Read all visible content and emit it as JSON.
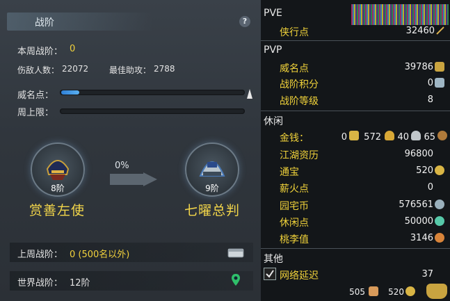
{
  "left": {
    "title": "战阶",
    "help_label": "?",
    "weekly_rank_label": "本周战阶：",
    "weekly_rank_value": "0",
    "kills_label": "伤敌人数：",
    "kills_value": "22072",
    "assist_label": "最佳助攻：",
    "assist_value": "2788",
    "fame_label": "威名点：",
    "fame_progress": 0.1,
    "weekly_cap_label": "周上限：",
    "weekly_cap_progress": 0,
    "current_rank": "8阶",
    "current_rank_name": "赏善左使",
    "progress_pct": "0%",
    "next_rank": "9阶",
    "next_rank_name": "七曜总判",
    "last_week_label": "上周战阶：",
    "last_week_value": "0 (500名以外)",
    "world_label": "世界战阶：",
    "world_value": "12阶"
  },
  "right": {
    "pve_title": "PVE",
    "pve_items": [
      {
        "label": "侠行点",
        "value": "32460"
      }
    ],
    "pvp_title": "PVP",
    "pvp_items": [
      {
        "label": "威名点",
        "value": "39786"
      },
      {
        "label": "战阶积分",
        "value": "0"
      },
      {
        "label": "战阶等级",
        "value": "8"
      }
    ],
    "leisure_title": "休闲",
    "money_label": "金钱：",
    "money_0": "0",
    "money_1": "572",
    "money_2": "40",
    "money_3": "65",
    "leisure_items": [
      {
        "label": "江湖资历",
        "value": "96800"
      },
      {
        "label": "通宝",
        "value": "520"
      },
      {
        "label": "薪火点",
        "value": "0"
      },
      {
        "label": "园宅币",
        "value": "576561"
      },
      {
        "label": "休闲点",
        "value": "50000"
      },
      {
        "label": "桃李值",
        "value": "3146"
      }
    ],
    "other_title": "其他",
    "latency_label": "网络延迟",
    "latency_value": "37",
    "footer_a": "505",
    "footer_b": "520"
  },
  "colors": {
    "accent_yellow": "#f2d23c",
    "bar_blue": "#3a8fe0"
  }
}
